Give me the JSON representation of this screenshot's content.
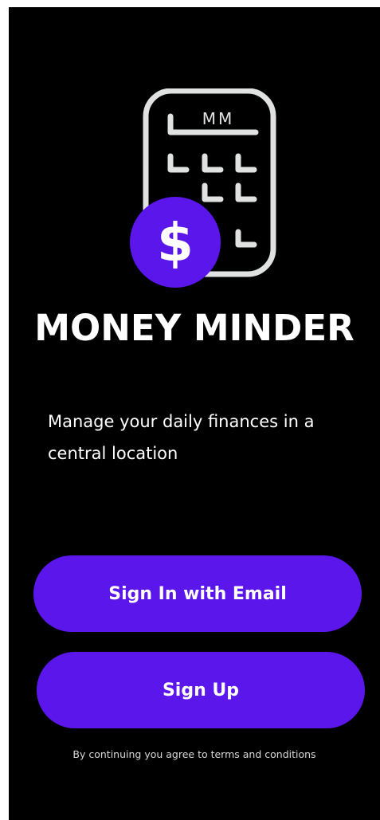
{
  "app": {
    "title": "MONEY MINDER",
    "tagline": "Manage your daily finances in a central location"
  },
  "logo": {
    "icon_name": "calculator-dollar-icon",
    "screen_text": "MM",
    "badge_symbol": "$"
  },
  "actions": {
    "signin_label": "Sign In with Email",
    "signup_label": "Sign Up"
  },
  "footer": {
    "terms_text": "By continuing you agree to terms and conditions"
  },
  "colors": {
    "background": "#000000",
    "accent": "#5b16ec",
    "logo_outline": "#e0e2e2",
    "text": "#ffffff"
  }
}
